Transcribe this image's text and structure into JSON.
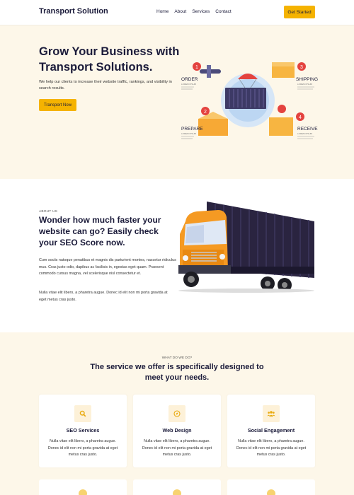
{
  "header": {
    "logo": "Transport Solution",
    "nav": [
      "Home",
      "About",
      "Services",
      "Contact"
    ],
    "cta": "Get Started"
  },
  "hero": {
    "title": "Grow Your Business with Transport Solutions.",
    "text": "We help our clients to increase their website traffic, rankings, and visibility in search results.",
    "button": "Transport Now",
    "steps": [
      {
        "num": "1",
        "label": "ORDER",
        "sub": "LOREM IPSUM"
      },
      {
        "num": "2",
        "label": "PREPARE",
        "sub": "LOREM IPSUM"
      },
      {
        "num": "3",
        "label": "SHIPPING",
        "sub": "LOREM IPSUM"
      },
      {
        "num": "4",
        "label": "RECEIVE",
        "sub": "LOREM IPSUM"
      }
    ]
  },
  "about": {
    "label": "ABOUT US",
    "title": "Wonder how much faster your website can go? Easily check your SEO Score now.",
    "p1": "Cum sociis natoque penatibus et magnis dis parturient montes, nascetur ridiculus mus. Cras justo odio, dapibus ac facilisis in, egestas eget quam. Praesent commodo cursus magna, vel scelerisque nisl consectetur et.",
    "p2": "Nulla vitae elit libero, a pharetra augue. Donec id elit non mi porta gravida at eget metus cras justo."
  },
  "services": {
    "label": "WHAT DO WE DO?",
    "title": "The service we offer is specifically designed to meet your needs.",
    "cards": [
      {
        "icon": "search-icon",
        "title": "SEO Services",
        "text": "Nulla vitae elit libero, a pharetra augue. Donec id elit non mi porta gravida at eget metus cras justo."
      },
      {
        "icon": "compass-icon",
        "title": "Web Design",
        "text": "Nulla vitae elit libero, a pharetra augue. Donec id elit non mi porta gravida at eget metus cras justo."
      },
      {
        "icon": "users-icon",
        "title": "Social Engagement",
        "text": "Nulla vitae elit libero, a pharetra augue. Donec id elit non mi porta gravida at eget metus cras justo."
      }
    ]
  },
  "colors": {
    "accent": "#f5b301",
    "navy": "#1b1b3a",
    "cream": "#fdf7e9",
    "truck_orange": "#f59a23",
    "trailer": "#2a2440"
  }
}
